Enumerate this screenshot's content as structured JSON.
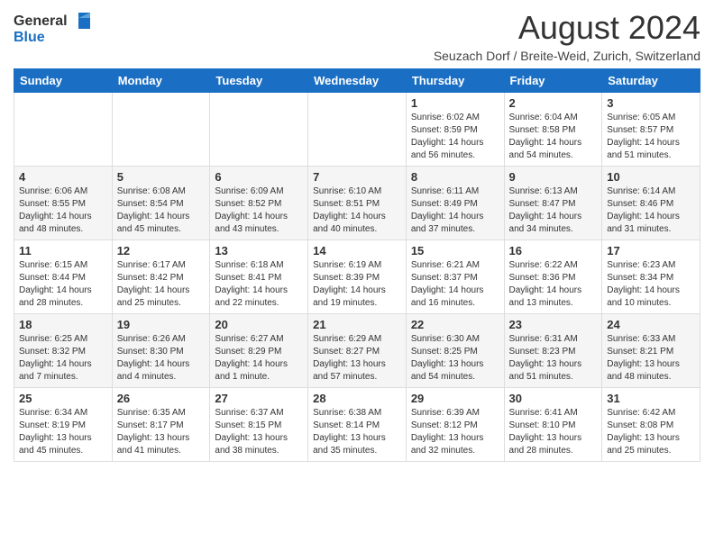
{
  "header": {
    "logo_text_general": "General",
    "logo_text_blue": "Blue",
    "title": "August 2024",
    "subtitle": "Seuzach Dorf / Breite-Weid, Zurich, Switzerland"
  },
  "days_of_week": [
    "Sunday",
    "Monday",
    "Tuesday",
    "Wednesday",
    "Thursday",
    "Friday",
    "Saturday"
  ],
  "weeks": [
    [
      {
        "day": "",
        "info": ""
      },
      {
        "day": "",
        "info": ""
      },
      {
        "day": "",
        "info": ""
      },
      {
        "day": "",
        "info": ""
      },
      {
        "day": "1",
        "info": "Sunrise: 6:02 AM\nSunset: 8:59 PM\nDaylight: 14 hours\nand 56 minutes."
      },
      {
        "day": "2",
        "info": "Sunrise: 6:04 AM\nSunset: 8:58 PM\nDaylight: 14 hours\nand 54 minutes."
      },
      {
        "day": "3",
        "info": "Sunrise: 6:05 AM\nSunset: 8:57 PM\nDaylight: 14 hours\nand 51 minutes."
      }
    ],
    [
      {
        "day": "4",
        "info": "Sunrise: 6:06 AM\nSunset: 8:55 PM\nDaylight: 14 hours\nand 48 minutes."
      },
      {
        "day": "5",
        "info": "Sunrise: 6:08 AM\nSunset: 8:54 PM\nDaylight: 14 hours\nand 45 minutes."
      },
      {
        "day": "6",
        "info": "Sunrise: 6:09 AM\nSunset: 8:52 PM\nDaylight: 14 hours\nand 43 minutes."
      },
      {
        "day": "7",
        "info": "Sunrise: 6:10 AM\nSunset: 8:51 PM\nDaylight: 14 hours\nand 40 minutes."
      },
      {
        "day": "8",
        "info": "Sunrise: 6:11 AM\nSunset: 8:49 PM\nDaylight: 14 hours\nand 37 minutes."
      },
      {
        "day": "9",
        "info": "Sunrise: 6:13 AM\nSunset: 8:47 PM\nDaylight: 14 hours\nand 34 minutes."
      },
      {
        "day": "10",
        "info": "Sunrise: 6:14 AM\nSunset: 8:46 PM\nDaylight: 14 hours\nand 31 minutes."
      }
    ],
    [
      {
        "day": "11",
        "info": "Sunrise: 6:15 AM\nSunset: 8:44 PM\nDaylight: 14 hours\nand 28 minutes."
      },
      {
        "day": "12",
        "info": "Sunrise: 6:17 AM\nSunset: 8:42 PM\nDaylight: 14 hours\nand 25 minutes."
      },
      {
        "day": "13",
        "info": "Sunrise: 6:18 AM\nSunset: 8:41 PM\nDaylight: 14 hours\nand 22 minutes."
      },
      {
        "day": "14",
        "info": "Sunrise: 6:19 AM\nSunset: 8:39 PM\nDaylight: 14 hours\nand 19 minutes."
      },
      {
        "day": "15",
        "info": "Sunrise: 6:21 AM\nSunset: 8:37 PM\nDaylight: 14 hours\nand 16 minutes."
      },
      {
        "day": "16",
        "info": "Sunrise: 6:22 AM\nSunset: 8:36 PM\nDaylight: 14 hours\nand 13 minutes."
      },
      {
        "day": "17",
        "info": "Sunrise: 6:23 AM\nSunset: 8:34 PM\nDaylight: 14 hours\nand 10 minutes."
      }
    ],
    [
      {
        "day": "18",
        "info": "Sunrise: 6:25 AM\nSunset: 8:32 PM\nDaylight: 14 hours\nand 7 minutes."
      },
      {
        "day": "19",
        "info": "Sunrise: 6:26 AM\nSunset: 8:30 PM\nDaylight: 14 hours\nand 4 minutes."
      },
      {
        "day": "20",
        "info": "Sunrise: 6:27 AM\nSunset: 8:29 PM\nDaylight: 14 hours\nand 1 minute."
      },
      {
        "day": "21",
        "info": "Sunrise: 6:29 AM\nSunset: 8:27 PM\nDaylight: 13 hours\nand 57 minutes."
      },
      {
        "day": "22",
        "info": "Sunrise: 6:30 AM\nSunset: 8:25 PM\nDaylight: 13 hours\nand 54 minutes."
      },
      {
        "day": "23",
        "info": "Sunrise: 6:31 AM\nSunset: 8:23 PM\nDaylight: 13 hours\nand 51 minutes."
      },
      {
        "day": "24",
        "info": "Sunrise: 6:33 AM\nSunset: 8:21 PM\nDaylight: 13 hours\nand 48 minutes."
      }
    ],
    [
      {
        "day": "25",
        "info": "Sunrise: 6:34 AM\nSunset: 8:19 PM\nDaylight: 13 hours\nand 45 minutes."
      },
      {
        "day": "26",
        "info": "Sunrise: 6:35 AM\nSunset: 8:17 PM\nDaylight: 13 hours\nand 41 minutes."
      },
      {
        "day": "27",
        "info": "Sunrise: 6:37 AM\nSunset: 8:15 PM\nDaylight: 13 hours\nand 38 minutes."
      },
      {
        "day": "28",
        "info": "Sunrise: 6:38 AM\nSunset: 8:14 PM\nDaylight: 13 hours\nand 35 minutes."
      },
      {
        "day": "29",
        "info": "Sunrise: 6:39 AM\nSunset: 8:12 PM\nDaylight: 13 hours\nand 32 minutes."
      },
      {
        "day": "30",
        "info": "Sunrise: 6:41 AM\nSunset: 8:10 PM\nDaylight: 13 hours\nand 28 minutes."
      },
      {
        "day": "31",
        "info": "Sunrise: 6:42 AM\nSunset: 8:08 PM\nDaylight: 13 hours\nand 25 minutes."
      }
    ]
  ]
}
